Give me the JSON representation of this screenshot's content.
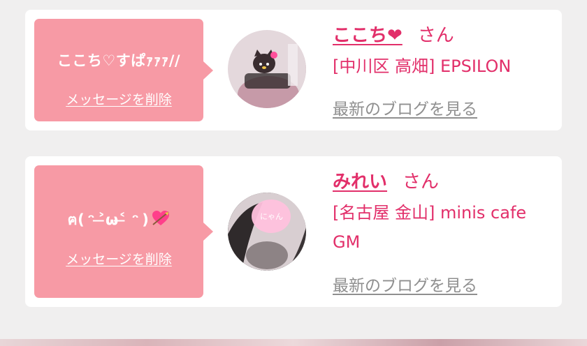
{
  "messages": [
    {
      "message_text": "ここち♡すぱｧｧｧ//",
      "delete_label": "メッセージを削除",
      "cast_name": "ここち❤",
      "honorific": "さん",
      "shop": "[中川区 高畑] EPSILON",
      "blog_label": "最新のブログを見る",
      "avatar_icon": "cast-avatar-icon"
    },
    {
      "message_text": "ฅ( ᵔ ˃̶ω˂̶ ᵔ )",
      "message_emoji": "heart-with-arrow-icon",
      "delete_label": "メッセージを削除",
      "cast_name": "みれい",
      "honorific": "さん",
      "shop": "[名古屋 金山] minis cafe GM",
      "blog_label": "最新のブログを見る",
      "avatar_icon": "cast-avatar-icon"
    }
  ],
  "colors": {
    "accent": "#e22f6a",
    "bubble": "#f79aa5",
    "background": "#f0efef",
    "muted_link": "#8f8f8f"
  }
}
